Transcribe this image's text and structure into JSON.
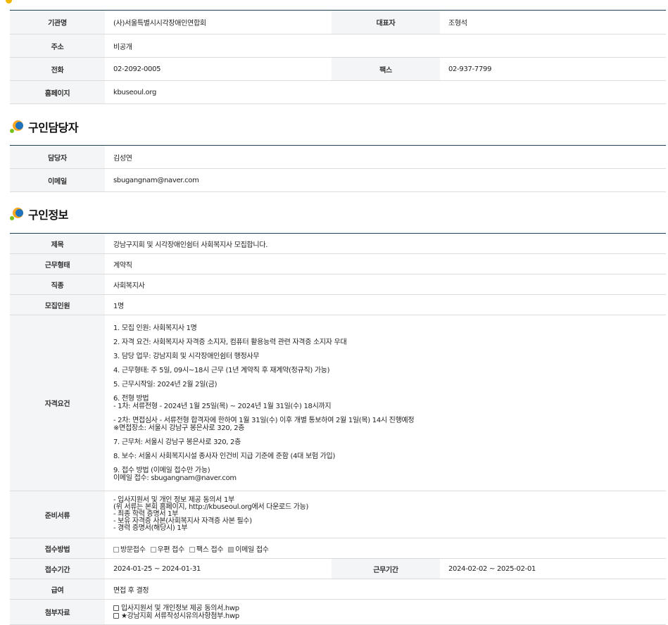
{
  "org": {
    "name_label": "기관명",
    "name": "(사)서울특별시시각장애인연합회",
    "rep_label": "대표자",
    "rep": "조형석",
    "addr_label": "주소",
    "addr": "비공개",
    "phone_label": "전화",
    "phone": "02-2092-0005",
    "fax_label": "팩스",
    "fax": "02-937-7799",
    "home_label": "홈페이지",
    "home": "kbuseoul.org"
  },
  "contact": {
    "title": "구인담당자",
    "person_label": "담당자",
    "person": "김성연",
    "email_label": "이메일",
    "email": "sbugangnam@naver.com"
  },
  "job": {
    "title": "구인정보",
    "subject_label": "제목",
    "subject": "강남구지회 및 시각장애인쉼터 사회복지사 모집합니다.",
    "type_label": "근무형태",
    "type": "계약직",
    "kind_label": "직종",
    "kind": "사회복지사",
    "count_label": "모집인원",
    "count": "1명",
    "req_label": "자격요건",
    "req": {
      "p1": "1. 모집 인원: 사회복지사 1명",
      "p2": "2. 자격 요건: 사회복지사 자격증 소지자, 컴퓨터 활용능력 관련 자격증 소지자 우대",
      "p3": "3. 담당 업무: 강남지회 및 시각장애인쉼터 행정사무",
      "p4": "4. 근무형태: 주 5일, 09시~18시 근무 (1년 계약직 후 재계약(정규직) 가능)",
      "p5": "5. 근무시작일: 2024년 2월 2일(금)",
      "p6a": "6. 전형 방법",
      "p6b": "- 1차: 서류전형 - 2024년 1월 25일(목) ~ 2024년 1월 31일(수) 18시까지",
      "p6c": "- 2차: 면접심사 - 서류전형 합격자에 한하여 1월 31일(수) 이후 개별 통보하여 2월 1일(목) 14시 진행예정",
      "p6d": "※면접장소: 서울시 강남구 봉은사로 320, 2층",
      "p7": "7. 근무처: 서울시 강남구 봉은사로 320, 2층",
      "p8": "8. 보수: 서울시 사회복지시설 종사자 인건비 지급 기준에 준함 (4대 보험 가입)",
      "p9a": "9. 접수 방법 (이메일 접수만 가능)",
      "p9b": "이메일 접수: sbugangnam@naver.com"
    },
    "docs_label": "준비서류",
    "docs": {
      "l1": "- 입사지원서 및 개인 정보 제공 동의서 1부",
      "l2": "(위 서류는 본회 홈페이지, http://kbuseoul.org에서 다운로드 가능)",
      "l3": "- 최종 학력 증명서 1부",
      "l4": "- 보유 자격증 사본(사회복지사 자격증 사본 필수)",
      "l5": "- 경력 증명서(해당시) 1부"
    },
    "method_label": "접수방법",
    "method": {
      "o1": "방문접수",
      "o2": "우편 접수",
      "o3": "팩스 접수",
      "o4": "이메일 접수"
    },
    "period_label": "접수기간",
    "period": "2024-01-25 ~ 2024-01-31",
    "work_period_label": "근무기간",
    "work_period": "2024-02-02 ~ 2025-02-01",
    "salary_label": "급여",
    "salary": "면접 후 결정",
    "attach_label": "첨부자료",
    "attach": {
      "f1": "입사지원서 및 개인정보 제공 동의서.hwp",
      "f2": "★강남지회 서류작성시유의사항첨부.hwp"
    }
  }
}
